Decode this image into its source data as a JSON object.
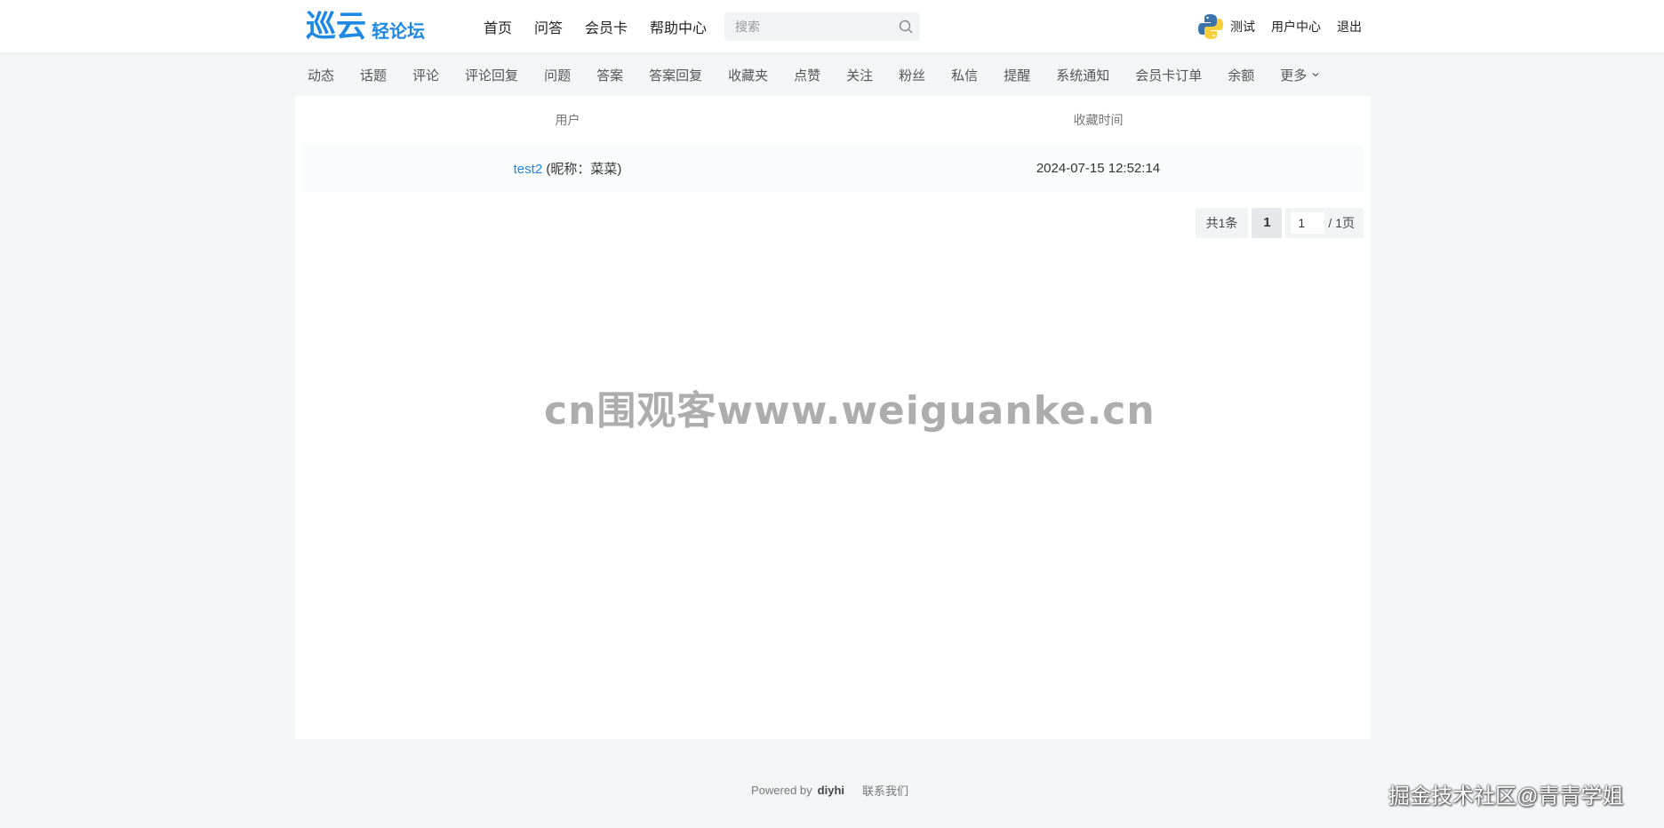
{
  "header": {
    "logo_main": "巡云",
    "logo_sub": "轻论坛",
    "nav": [
      "首页",
      "问答",
      "会员卡",
      "帮助中心"
    ],
    "search_placeholder": "搜索",
    "user_name": "测试",
    "user_center": "用户中心",
    "logout": "退出"
  },
  "subnav": {
    "items": [
      "动态",
      "话题",
      "评论",
      "评论回复",
      "问题",
      "答案",
      "答案回复",
      "收藏夹",
      "点赞",
      "关注",
      "粉丝",
      "私信",
      "提醒",
      "系统通知",
      "会员卡订单",
      "余额"
    ],
    "more": "更多"
  },
  "table": {
    "headers": [
      "用户",
      "收藏时间"
    ],
    "rows": [
      {
        "user": "test2",
        "nickname": " (昵称：菜菜)",
        "time": "2024-07-15 12:52:14"
      }
    ]
  },
  "pager": {
    "total": "共1条",
    "current": "1",
    "jump_value": "1",
    "pages": "/ 1页"
  },
  "watermark": "cn围观客www.weiguanke.cn",
  "footer": {
    "powered_by": "Powered by",
    "brand": "diyhi",
    "contact": "联系我们"
  },
  "corner_mark": "掘金技术社区@青青学姐",
  "colors": {
    "accent": "#1e88e5",
    "background": "#f4f5f7"
  }
}
